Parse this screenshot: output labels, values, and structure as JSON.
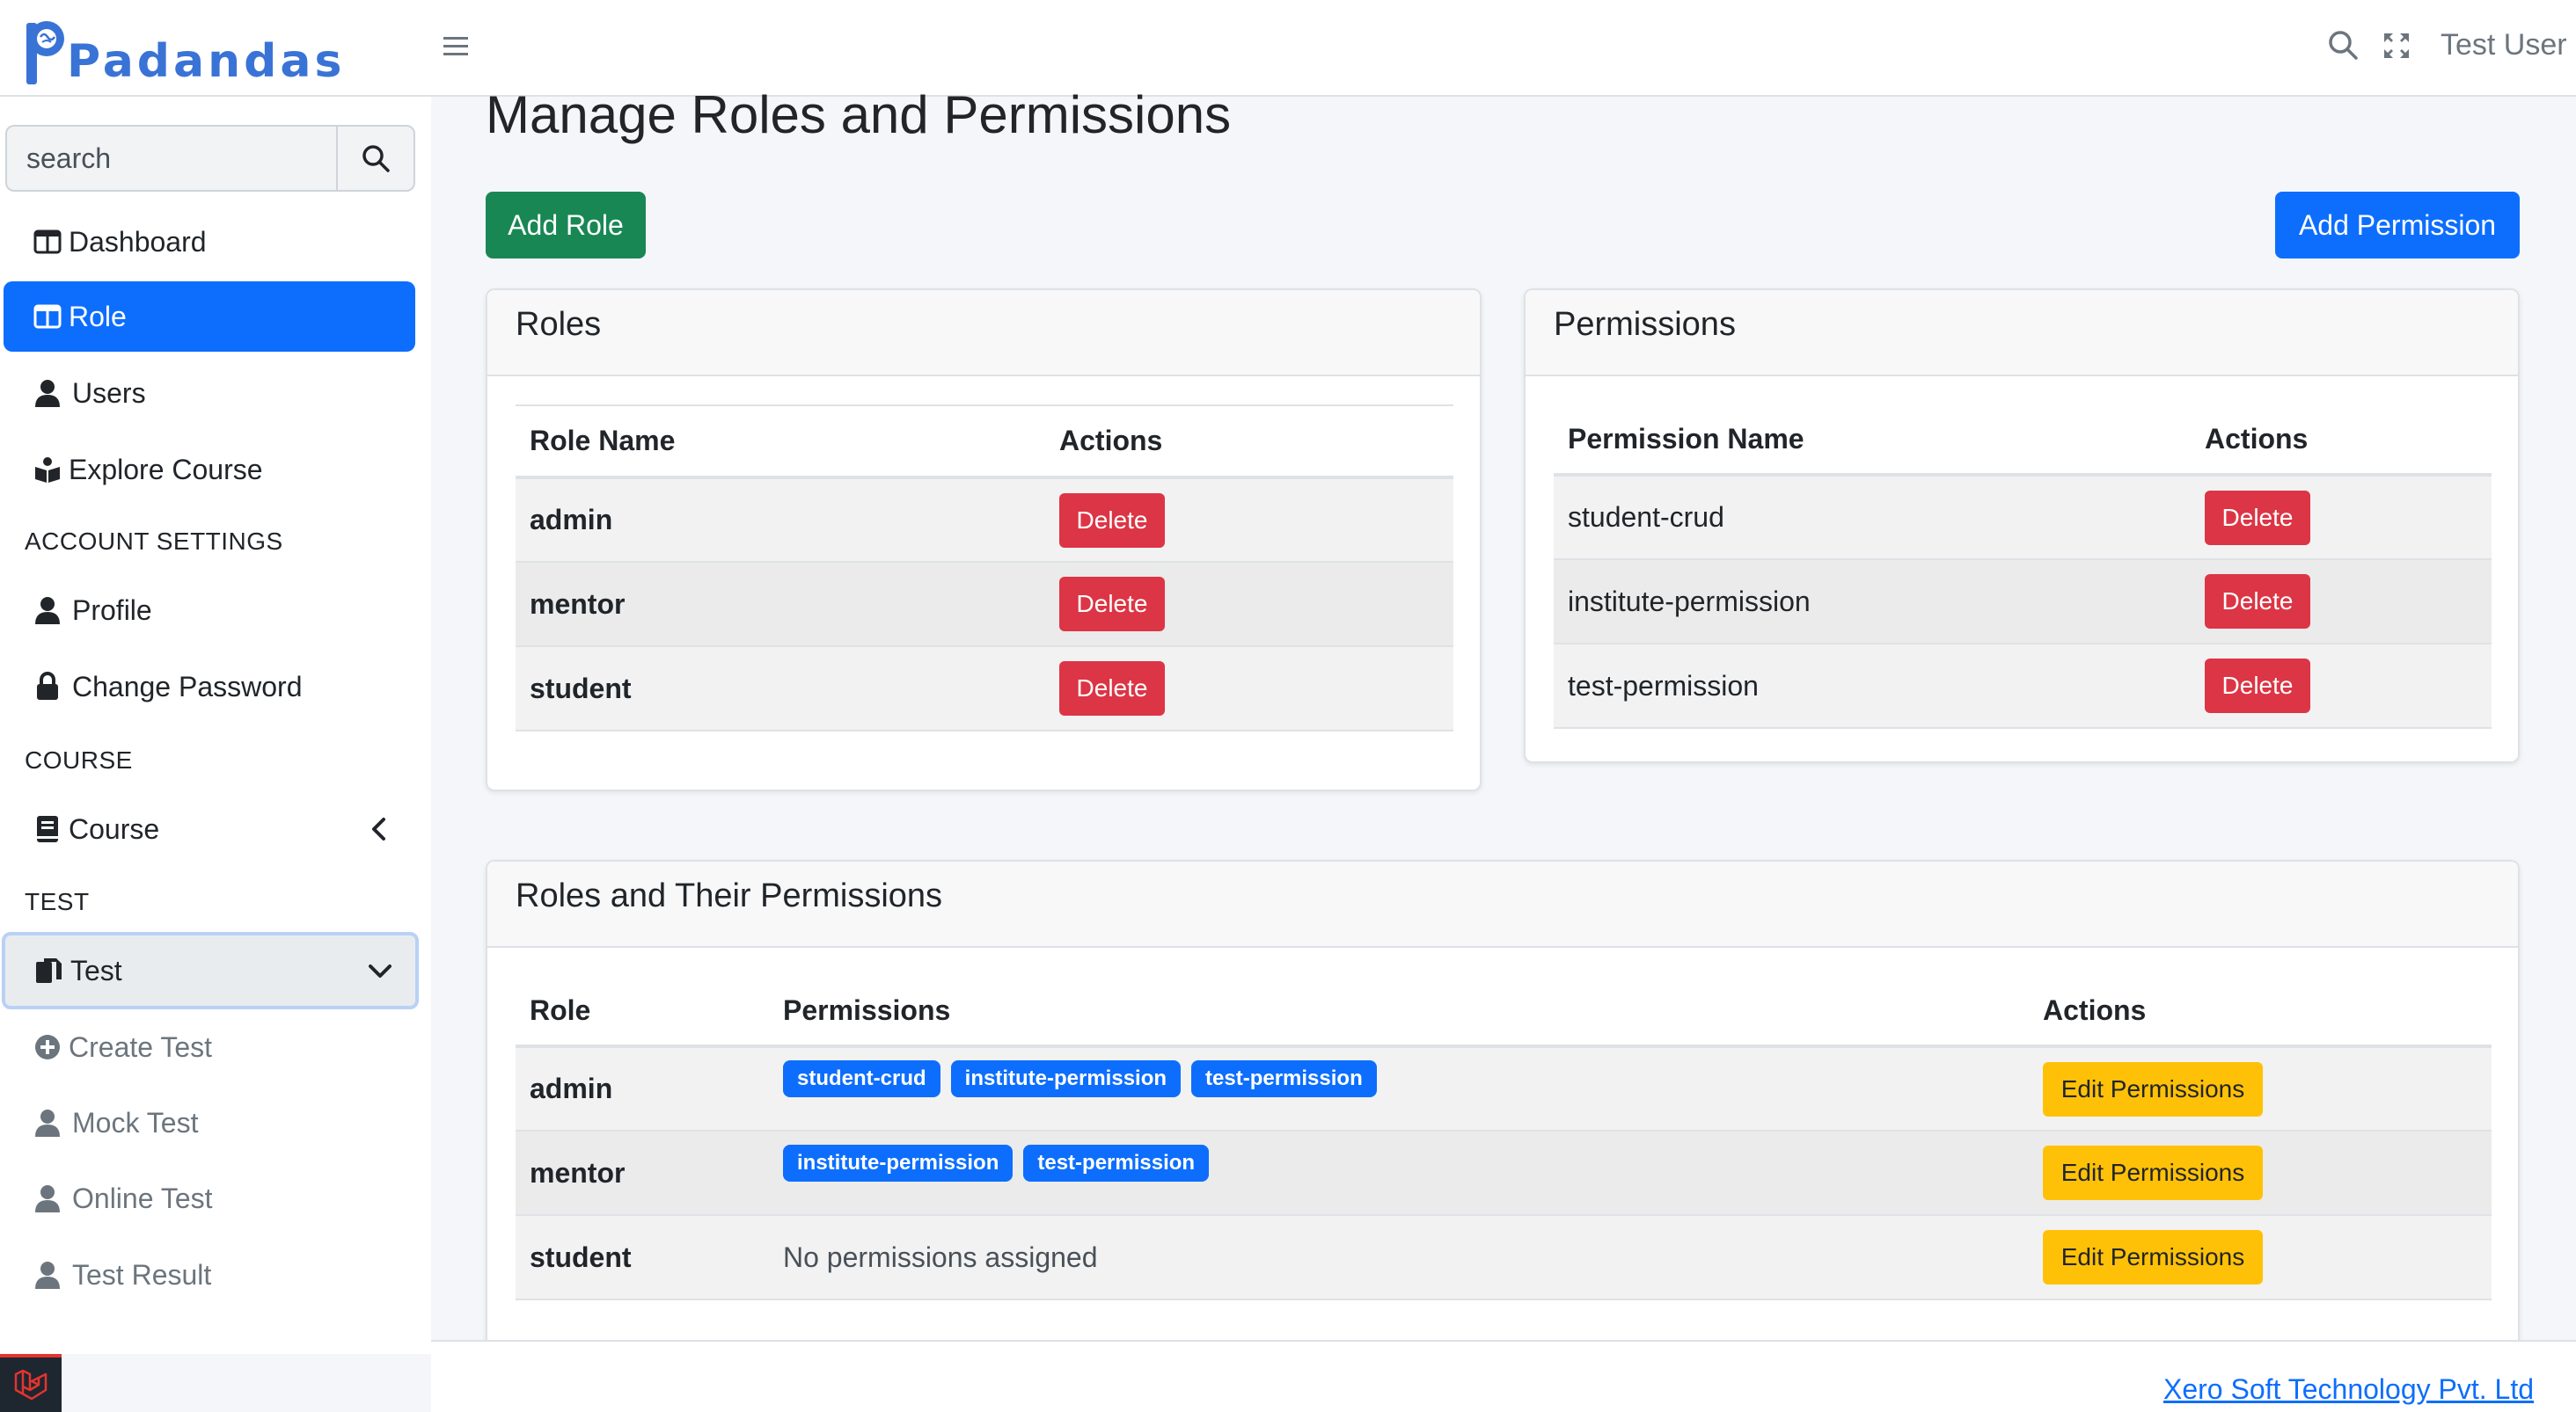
{
  "brand": {
    "name": "Padandas"
  },
  "header": {
    "user_name": "Test User"
  },
  "sidebar": {
    "search_placeholder": "search",
    "items": [
      {
        "label": "Dashboard"
      },
      {
        "label": "Role"
      },
      {
        "label": "Users"
      },
      {
        "label": "Explore Course"
      }
    ],
    "account_header": "ACCOUNT SETTINGS",
    "account_items": [
      {
        "label": "Profile"
      },
      {
        "label": "Change Password"
      }
    ],
    "course_header": "COURSE",
    "course_item": "Course",
    "test_header": "TEST",
    "test_item": "Test",
    "test_sub_items": [
      {
        "label": "Create Test"
      },
      {
        "label": "Mock Test"
      },
      {
        "label": "Online Test"
      },
      {
        "label": "Test Result"
      }
    ]
  },
  "main": {
    "title": "Manage Roles and Permissions",
    "add_role_label": "Add Role",
    "add_permission_label": "Add Permission",
    "roles_card": {
      "title": "Roles",
      "col_name": "Role Name",
      "col_actions": "Actions",
      "rows": [
        {
          "name": "admin",
          "action": "Delete"
        },
        {
          "name": "mentor",
          "action": "Delete"
        },
        {
          "name": "student",
          "action": "Delete"
        }
      ]
    },
    "permissions_card": {
      "title": "Permissions",
      "col_name": "Permission Name",
      "col_actions": "Actions",
      "rows": [
        {
          "name": "student-crud",
          "action": "Delete"
        },
        {
          "name": "institute-permission",
          "action": "Delete"
        },
        {
          "name": "test-permission",
          "action": "Delete"
        }
      ]
    },
    "role_permissions_card": {
      "title": "Roles and Their Permissions",
      "col_role": "Role",
      "col_permissions": "Permissions",
      "col_actions": "Actions",
      "rows": [
        {
          "role": "admin",
          "permissions": [
            "student-crud",
            "institute-permission",
            "test-permission"
          ],
          "action": "Edit Permissions"
        },
        {
          "role": "mentor",
          "permissions": [
            "institute-permission",
            "test-permission"
          ],
          "action": "Edit Permissions"
        },
        {
          "role": "student",
          "permissions": [],
          "empty_text": "No permissions assigned",
          "action": "Edit Permissions"
        }
      ]
    }
  },
  "footer": {
    "link_text": "Xero Soft Technology Pvt. Ltd"
  },
  "colors": {
    "primary": "#0d6efd",
    "success": "#198754",
    "danger": "#dc3545",
    "warning": "#ffc107",
    "brand": "#3a73d6"
  }
}
